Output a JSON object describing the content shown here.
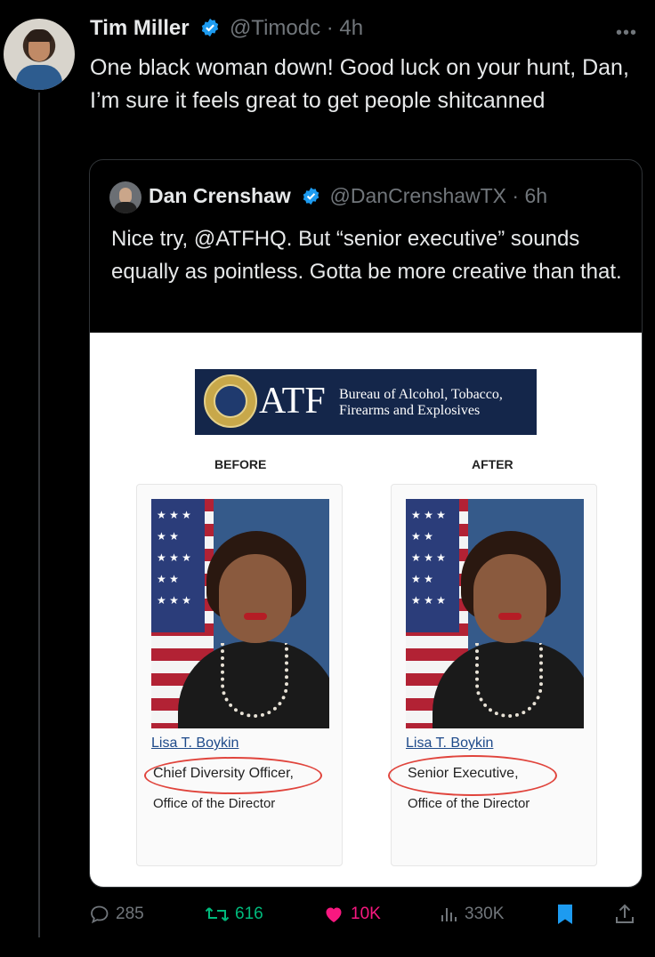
{
  "tweet": {
    "author_name": "Tim Miller",
    "handle": "@Timodc",
    "time": "· 4h",
    "text": "One black woman down! Good luck on your hunt, Dan, I’m sure it feels great to get people shitcanned",
    "more_icon": "more-icon"
  },
  "quote": {
    "author_name": "Dan Crenshaw",
    "handle": "@DanCrenshawTX",
    "time": "· 6h",
    "text": "Nice try, @ATFHQ. But “senior executive” sounds equally as pointless. Gotta be more creative than that.",
    "image": {
      "atf_letters": "ATF",
      "atf_line1": "Bureau of Alcohol, Tobacco,",
      "atf_line2": "Firearms and Explosives",
      "before_label": "BEFORE",
      "after_label": "AFTER",
      "before": {
        "name": "Lisa T. Boykin",
        "title": "Chief Diversity Officer,",
        "office": "Office of the Director"
      },
      "after": {
        "name": "Lisa T. Boykin",
        "title": "Senior Executive,",
        "office": "Office of the Director"
      }
    }
  },
  "actions": {
    "replies": "285",
    "reposts": "616",
    "likes": "10K",
    "views": "330K"
  },
  "colors": {
    "background": "#000000",
    "muted": "#71767b",
    "verified": "#1d9bf0",
    "repost": "#00ba7c",
    "like": "#f91880",
    "bookmark": "#1d9bf0",
    "circle": "#e0443c"
  }
}
